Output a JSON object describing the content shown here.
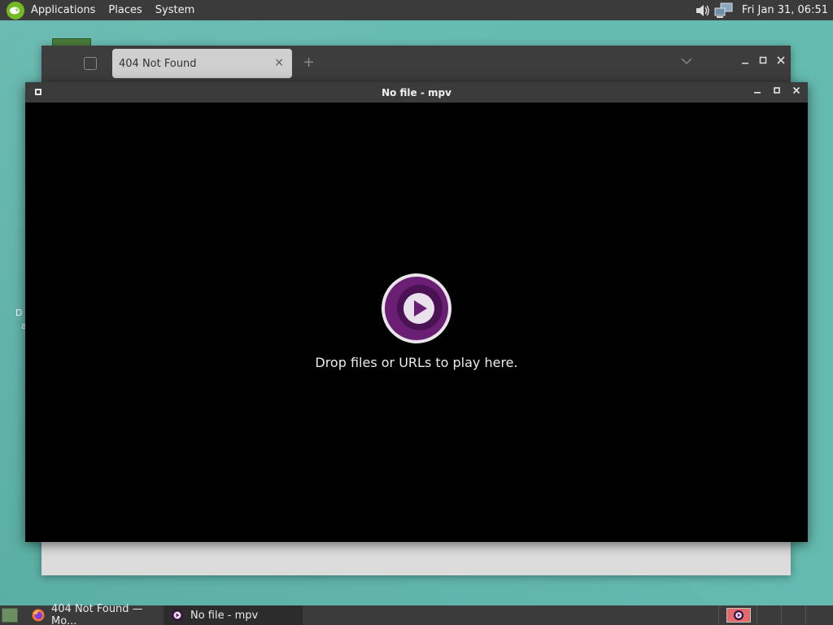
{
  "top_panel": {
    "menus": [
      "Applications",
      "Places",
      "System"
    ],
    "clock": "Fri Jan 31, 06:51",
    "icons": [
      "suse-logo-icon",
      "volume-icon",
      "network-icon"
    ]
  },
  "desktop": {
    "partial_labels": [
      "D",
      "a"
    ]
  },
  "firefox": {
    "tab_title": "404 Not Found",
    "tab_close": "×",
    "new_tab": "+"
  },
  "mpv": {
    "title": "No file - mpv",
    "drop_message": "Drop files or URLs to play here."
  },
  "taskbar": {
    "tasks": [
      {
        "label": "404 Not Found — Mo...",
        "icon": "firefox-icon"
      },
      {
        "label": "No file - mpv",
        "icon": "mpv-icon"
      }
    ]
  },
  "colors": {
    "desktop": "#5fb8ad",
    "panel": "#3b3b3b",
    "mpv_purple": "#6a1f75",
    "opensuse_green": "#73ba25"
  }
}
